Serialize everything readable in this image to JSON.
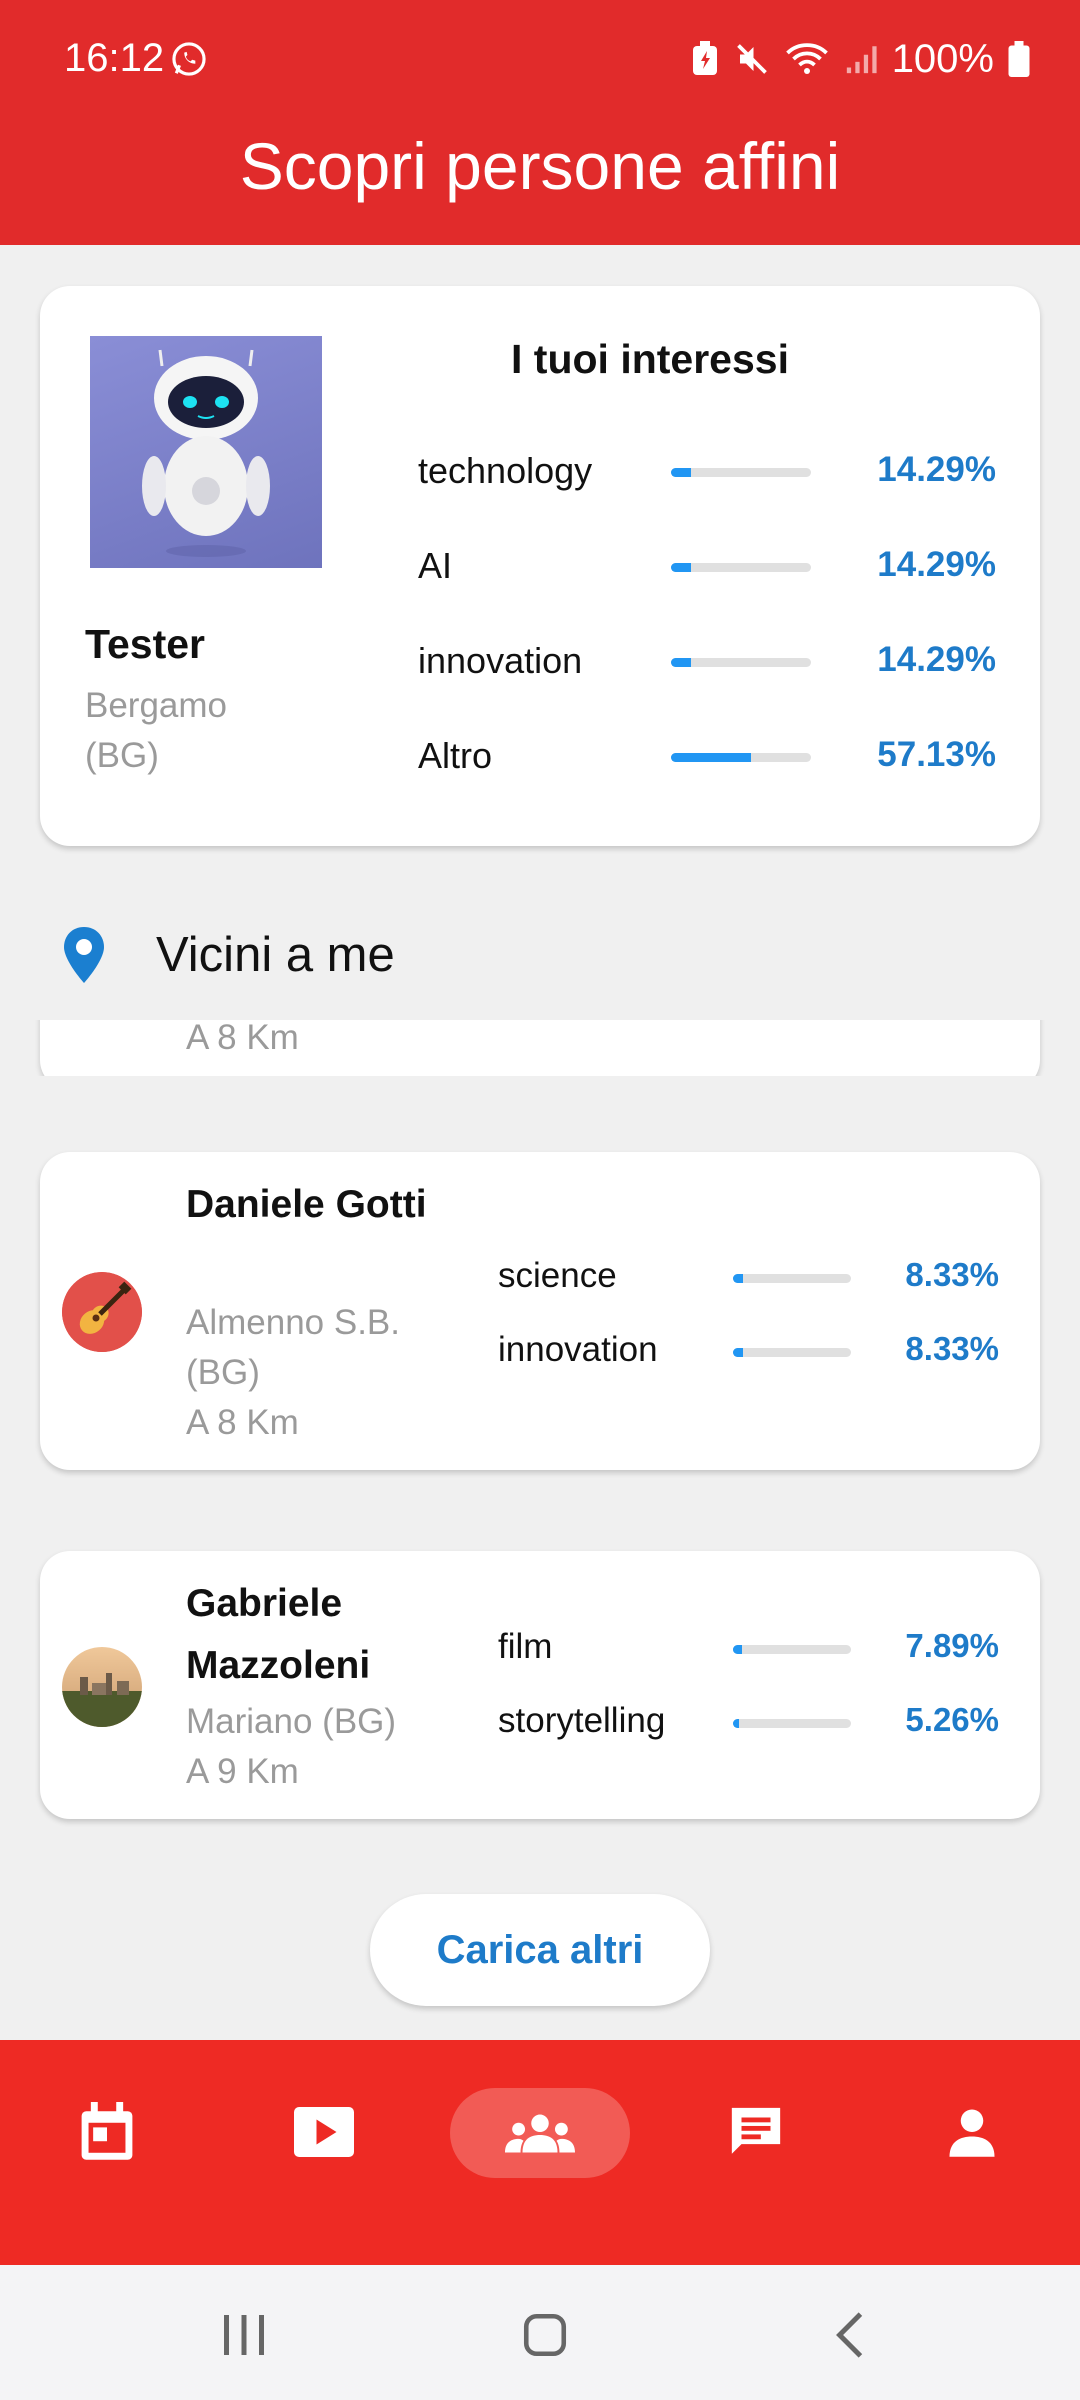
{
  "status_bar": {
    "time": "16:12",
    "battery": "100%"
  },
  "header": {
    "title": "Scopri persone affini"
  },
  "profile": {
    "name": "Tester",
    "location": "Bergamo (BG)",
    "interests_title": "I tuoi interessi",
    "interests": [
      {
        "label": "technology",
        "percent": "14.29%",
        "value": 0.1429
      },
      {
        "label": "AI",
        "percent": "14.29%",
        "value": 0.1429
      },
      {
        "label": "innovation",
        "percent": "14.29%",
        "value": 0.1429
      },
      {
        "label": "Altro",
        "percent": "57.13%",
        "value": 0.5713
      }
    ]
  },
  "section": {
    "title": "Vicini a me"
  },
  "clipped_card": {
    "distance": "A 8 Km"
  },
  "people": [
    {
      "name": "Daniele Gotti",
      "location": "Almenno S.B. (BG)",
      "distance": "A 8 Km",
      "interests": [
        {
          "label": "science",
          "percent": "8.33%",
          "value": 0.0833
        },
        {
          "label": "innovation",
          "percent": "8.33%",
          "value": 0.0833
        }
      ]
    },
    {
      "name": "Gabriele Mazzoleni",
      "location": "Mariano (BG)",
      "distance": "A 9 Km",
      "interests": [
        {
          "label": "film",
          "percent": "7.89%",
          "value": 0.0789
        },
        {
          "label": "storytelling",
          "percent": "5.26%",
          "value": 0.0526
        }
      ]
    }
  ],
  "load_more_label": "Carica altri",
  "bottom_nav": {
    "items": [
      "calendar-icon",
      "video-play-icon",
      "people-group-icon",
      "chat-icon",
      "person-icon"
    ],
    "active_index": 2
  },
  "colors": {
    "header_red": "#e12b2b",
    "nav_red": "#ee2a24",
    "accent_blue": "#1e7bc9",
    "bar_blue": "#2196f3"
  }
}
